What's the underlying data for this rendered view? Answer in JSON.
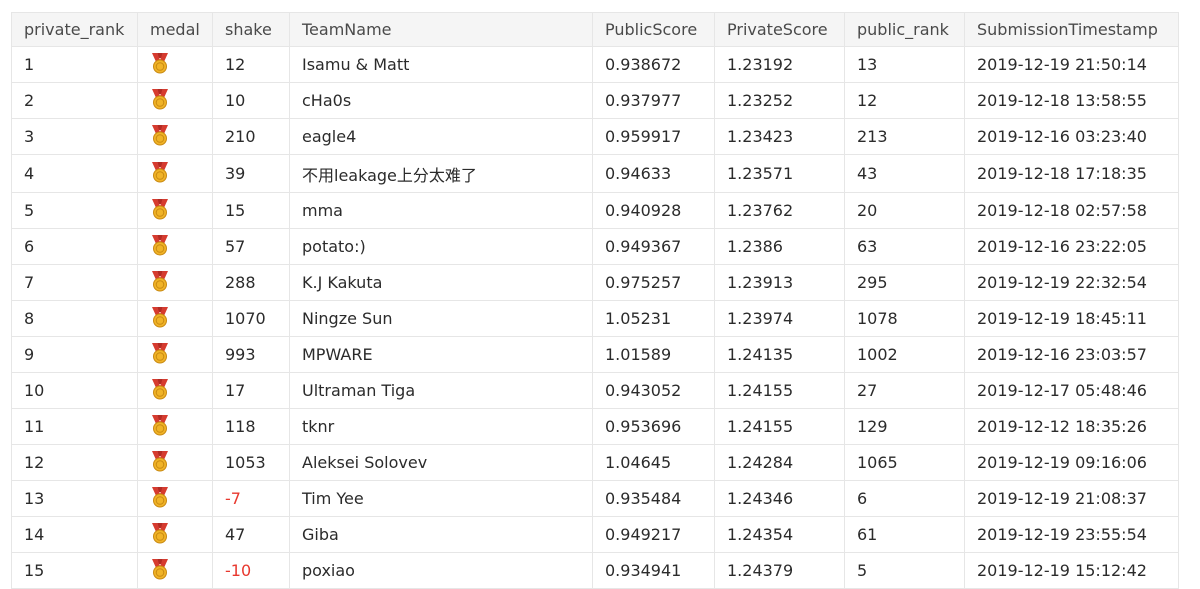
{
  "headers": [
    "private_rank",
    "medal",
    "shake",
    "TeamName",
    "PublicScore",
    "PrivateScore",
    "public_rank",
    "SubmissionTimestamp"
  ],
  "colors": {
    "negative": "#e8382e",
    "medal_gold": "#f0b327",
    "medal_ribbon": "#d63b2f"
  },
  "medal_icon": "gold-medal-icon",
  "rows": [
    {
      "private_rank": "1",
      "shake": "12",
      "team": "Isamu & Matt",
      "public_score": "0.938672",
      "private_score": "1.23192",
      "public_rank": "13",
      "timestamp": "2019-12-19 21:50:14"
    },
    {
      "private_rank": "2",
      "shake": "10",
      "team": "cHa0s",
      "public_score": "0.937977",
      "private_score": "1.23252",
      "public_rank": "12",
      "timestamp": "2019-12-18 13:58:55"
    },
    {
      "private_rank": "3",
      "shake": "210",
      "team": "eagle4",
      "public_score": "0.959917",
      "private_score": "1.23423",
      "public_rank": "213",
      "timestamp": "2019-12-16 03:23:40"
    },
    {
      "private_rank": "4",
      "shake": "39",
      "team": "不用leakage上分太难了",
      "public_score": "0.94633",
      "private_score": "1.23571",
      "public_rank": "43",
      "timestamp": "2019-12-18 17:18:35"
    },
    {
      "private_rank": "5",
      "shake": "15",
      "team": "mma",
      "public_score": "0.940928",
      "private_score": "1.23762",
      "public_rank": "20",
      "timestamp": "2019-12-18 02:57:58"
    },
    {
      "private_rank": "6",
      "shake": "57",
      "team": "potato:)",
      "public_score": "0.949367",
      "private_score": "1.2386",
      "public_rank": "63",
      "timestamp": "2019-12-16 23:22:05"
    },
    {
      "private_rank": "7",
      "shake": "288",
      "team": "K.J Kakuta",
      "public_score": "0.975257",
      "private_score": "1.23913",
      "public_rank": "295",
      "timestamp": "2019-12-19 22:32:54"
    },
    {
      "private_rank": "8",
      "shake": "1070",
      "team": "Ningze Sun",
      "public_score": "1.05231",
      "private_score": "1.23974",
      "public_rank": "1078",
      "timestamp": "2019-12-19 18:45:11"
    },
    {
      "private_rank": "9",
      "shake": "993",
      "team": "MPWARE",
      "public_score": "1.01589",
      "private_score": "1.24135",
      "public_rank": "1002",
      "timestamp": "2019-12-16 23:03:57"
    },
    {
      "private_rank": "10",
      "shake": "17",
      "team": "Ultraman Tiga",
      "public_score": "0.943052",
      "private_score": "1.24155",
      "public_rank": "27",
      "timestamp": "2019-12-17 05:48:46"
    },
    {
      "private_rank": "11",
      "shake": "118",
      "team": "tknr",
      "public_score": "0.953696",
      "private_score": "1.24155",
      "public_rank": "129",
      "timestamp": "2019-12-12 18:35:26"
    },
    {
      "private_rank": "12",
      "shake": "1053",
      "team": "Aleksei Solovev",
      "public_score": "1.04645",
      "private_score": "1.24284",
      "public_rank": "1065",
      "timestamp": "2019-12-19 09:16:06"
    },
    {
      "private_rank": "13",
      "shake": "-7",
      "team": "Tim Yee",
      "public_score": "0.935484",
      "private_score": "1.24346",
      "public_rank": "6",
      "timestamp": "2019-12-19 21:08:37"
    },
    {
      "private_rank": "14",
      "shake": "47",
      "team": "Giba",
      "public_score": "0.949217",
      "private_score": "1.24354",
      "public_rank": "61",
      "timestamp": "2019-12-19 23:55:54"
    },
    {
      "private_rank": "15",
      "shake": "-10",
      "team": "poxiao",
      "public_score": "0.934941",
      "private_score": "1.24379",
      "public_rank": "5",
      "timestamp": "2019-12-19 15:12:42"
    }
  ]
}
